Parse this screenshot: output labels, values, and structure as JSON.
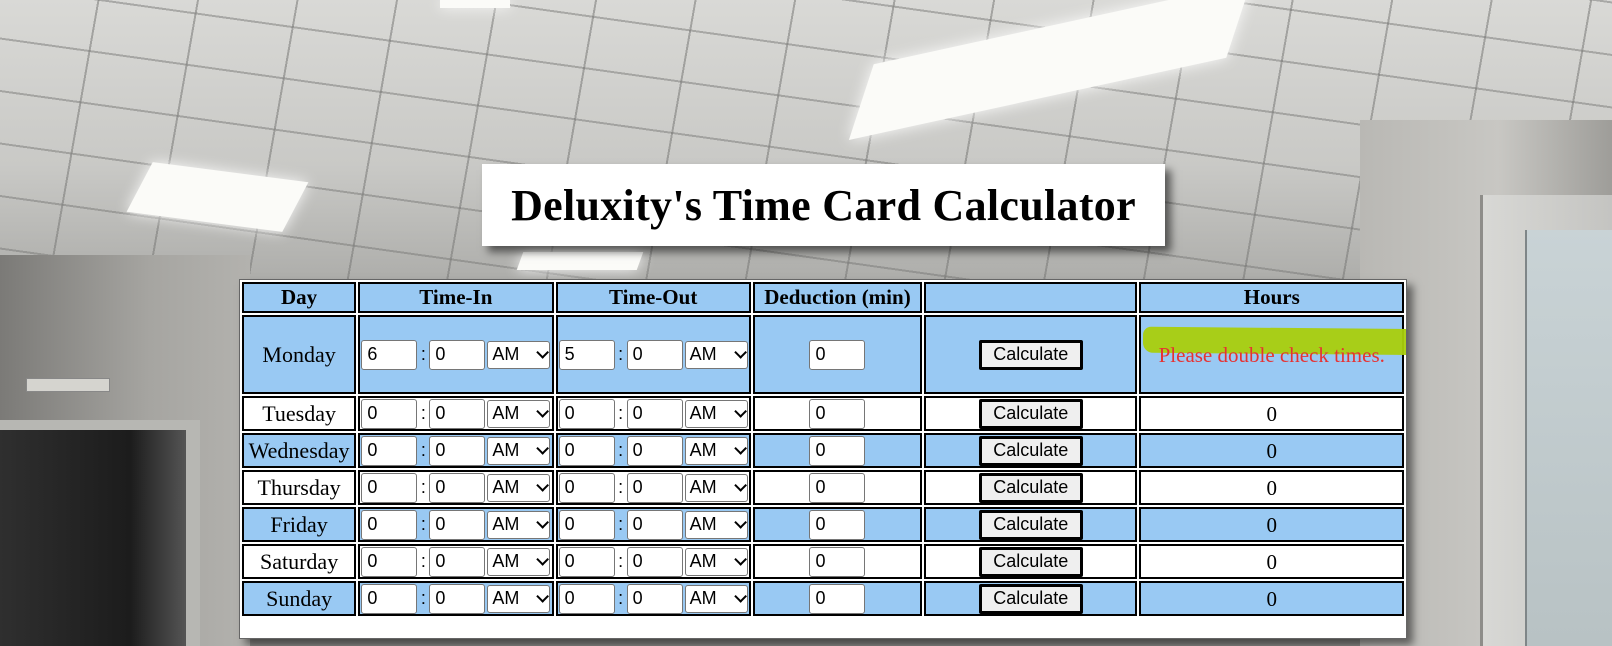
{
  "page": {
    "title": "Deluxity's Time Card Calculator"
  },
  "table": {
    "headers": {
      "day": "Day",
      "time_in": "Time-In",
      "time_out": "Time-Out",
      "deduction": "Deduction (min)",
      "calculate": "",
      "hours": "Hours"
    },
    "rows": [
      {
        "day": "Monday",
        "in_hour": "6",
        "in_min": "0",
        "in_ampm": "AM",
        "out_hour": "5",
        "out_min": "0",
        "out_ampm": "AM",
        "deduction": "0",
        "button": "Calculate",
        "hours": "Please double check times."
      },
      {
        "day": "Tuesday",
        "in_hour": "0",
        "in_min": "0",
        "in_ampm": "AM",
        "out_hour": "0",
        "out_min": "0",
        "out_ampm": "AM",
        "deduction": "0",
        "button": "Calculate",
        "hours": "0"
      },
      {
        "day": "Wednesday",
        "in_hour": "0",
        "in_min": "0",
        "in_ampm": "AM",
        "out_hour": "0",
        "out_min": "0",
        "out_ampm": "AM",
        "deduction": "0",
        "button": "Calculate",
        "hours": "0"
      },
      {
        "day": "Thursday",
        "in_hour": "0",
        "in_min": "0",
        "in_ampm": "AM",
        "out_hour": "0",
        "out_min": "0",
        "out_ampm": "AM",
        "deduction": "0",
        "button": "Calculate",
        "hours": "0"
      },
      {
        "day": "Friday",
        "in_hour": "0",
        "in_min": "0",
        "in_ampm": "AM",
        "out_hour": "0",
        "out_min": "0",
        "out_ampm": "AM",
        "deduction": "0",
        "button": "Calculate",
        "hours": "0"
      },
      {
        "day": "Saturday",
        "in_hour": "0",
        "in_min": "0",
        "in_ampm": "AM",
        "out_hour": "0",
        "out_min": "0",
        "out_ampm": "AM",
        "deduction": "0",
        "button": "Calculate",
        "hours": "0"
      },
      {
        "day": "Sunday",
        "in_hour": "0",
        "in_min": "0",
        "in_ampm": "AM",
        "out_hour": "0",
        "out_min": "0",
        "out_ampm": "AM",
        "deduction": "0",
        "button": "Calculate",
        "hours": "0"
      }
    ]
  },
  "colors": {
    "header_bg": "#99c9f3",
    "alt_row_bg": "#99c9f3",
    "warning_text": "#e63232",
    "warning_highlight": "#a9cf0c"
  },
  "icons": {
    "select_arrow": "chevron-down-icon"
  }
}
